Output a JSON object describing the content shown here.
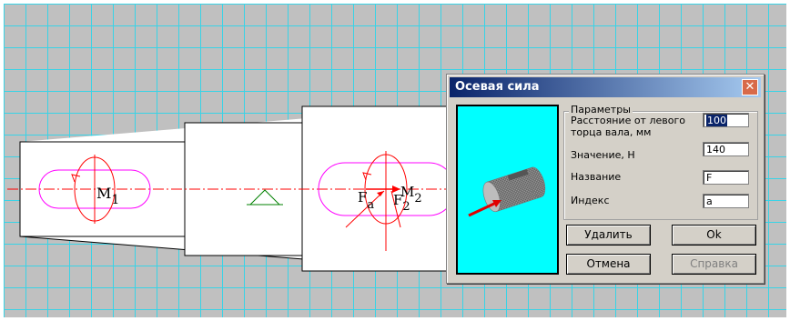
{
  "drawing": {
    "labels": {
      "m1_main": "M",
      "m1_sub": "1",
      "m2_main": "M",
      "m2_sub": "2",
      "f2_main": "F",
      "f2_sub": "2",
      "fa_main": "F",
      "fa_sub": "a"
    },
    "colors": {
      "grid": "#39d3e6",
      "background": "#c0c0c0",
      "outline": "#000000",
      "moment": "#ff00ff",
      "force": "#ff0000",
      "support": "#008000",
      "axis": "#ff0000"
    }
  },
  "dialog": {
    "title": "Осевая сила",
    "close_icon": "close-icon",
    "group_title": "Параметры",
    "fields": {
      "distance_label": "Расстояние от левого торца вала, мм",
      "distance_value": "100",
      "value_label": "Значение, Н",
      "value_value": "140",
      "name_label": "Название",
      "name_value": "F",
      "index_label": "Индекс",
      "index_value": "a"
    },
    "buttons": {
      "delete": "Удалить",
      "ok": "Ok",
      "cancel": "Отмена",
      "help": "Справка"
    },
    "preview_icon": "axial-force-shaft-icon",
    "colors": {
      "titlebar_start": "#0a246a",
      "titlebar_end": "#a6caf0",
      "preview_bg": "#00ffff",
      "face": "#d4d0c8"
    }
  }
}
